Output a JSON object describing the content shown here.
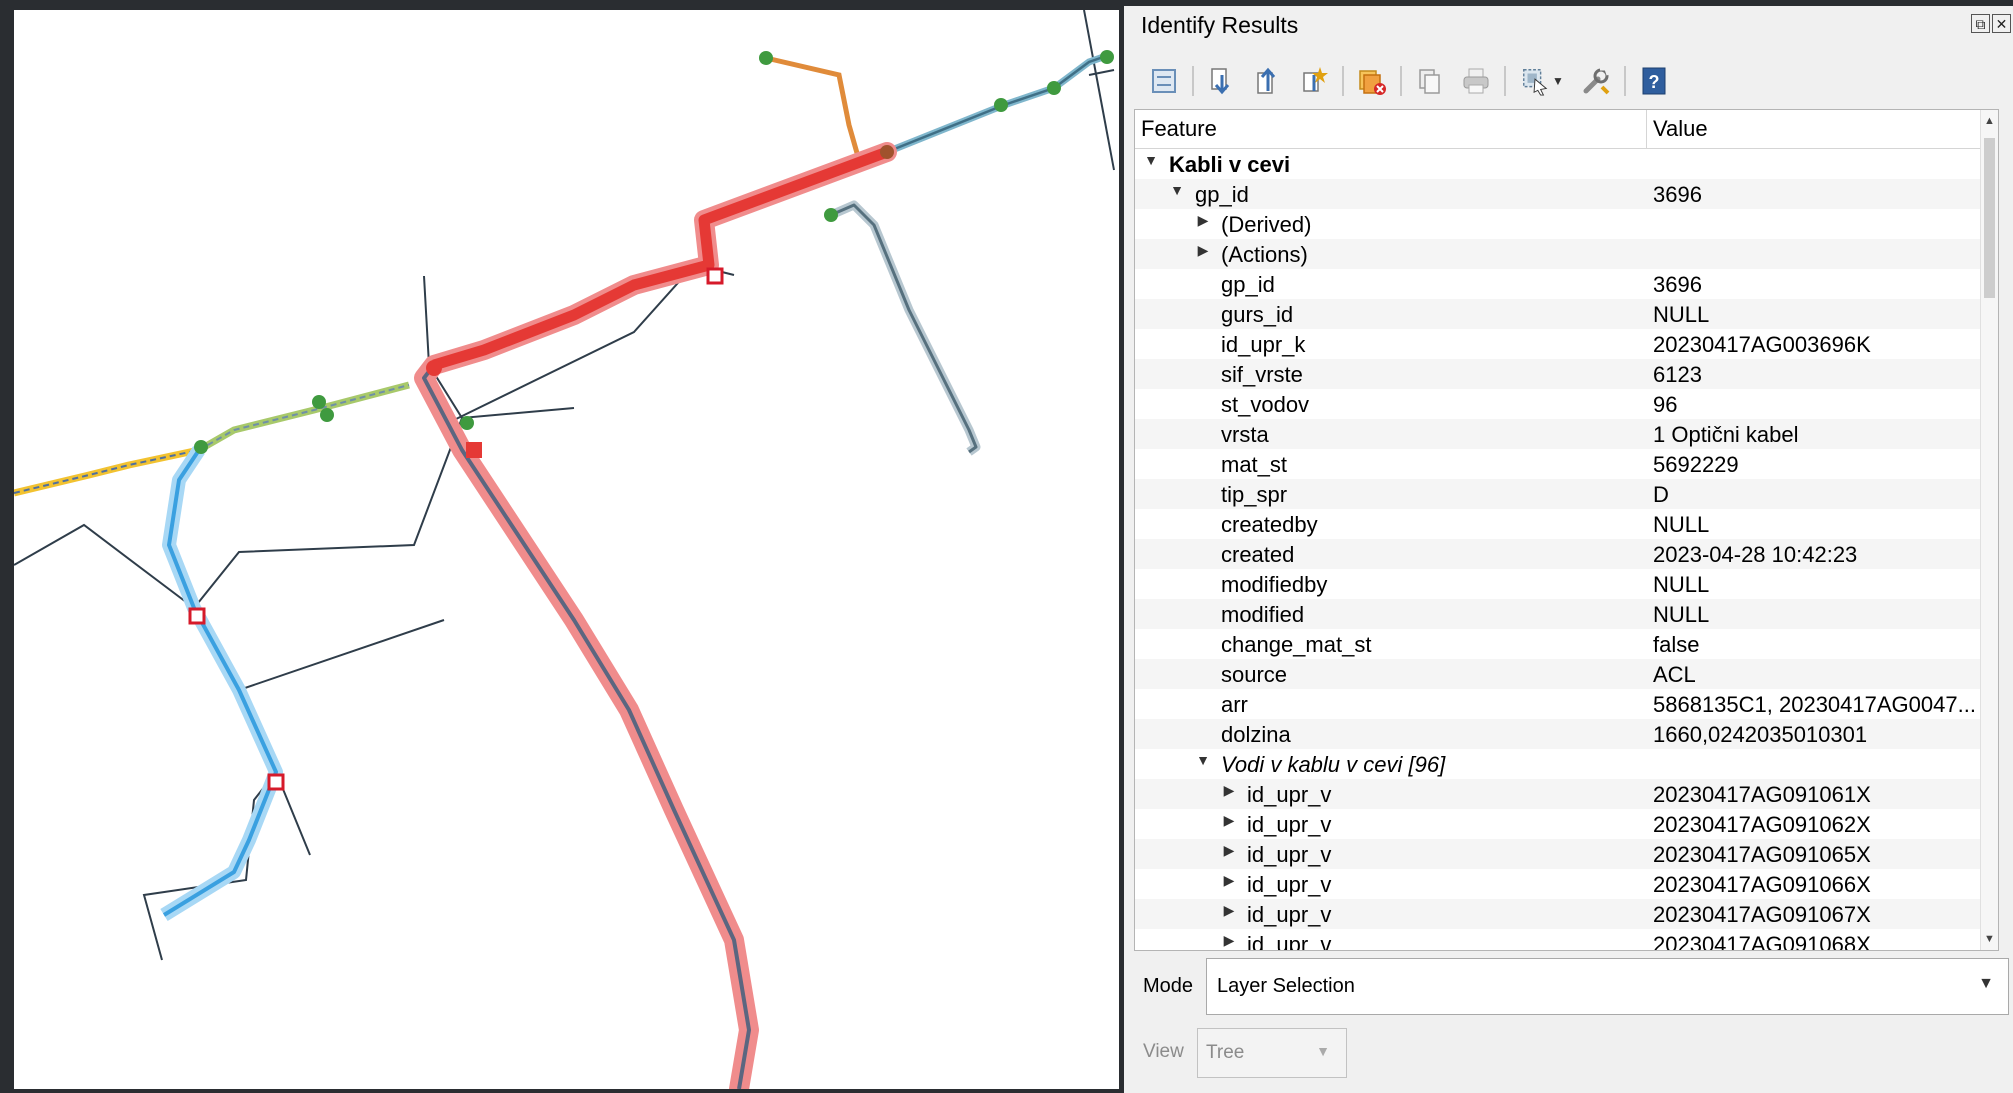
{
  "panel": {
    "title": "Identify Results",
    "restore_glyph": "⧉",
    "close_glyph": "✕",
    "toolbar": [
      {
        "name": "expand-tree-icon",
        "color": "#6a8fb8"
      },
      {
        "name": "expand-all-icon",
        "color": "#3b6fb0"
      },
      {
        "name": "collapse-all-icon",
        "color": "#3b6fb0"
      },
      {
        "name": "expand-new-results-icon",
        "color": "#e0a010"
      },
      {
        "name": "clear-results-icon",
        "color": "#e08010"
      },
      {
        "name": "copy-feature-icon",
        "color": "#9a9a9a"
      },
      {
        "name": "print-icon",
        "color": "#9a9a9a"
      },
      {
        "name": "select-features-icon",
        "color": "#5f7e98"
      },
      {
        "name": "settings-wrench-icon",
        "color": "#8a8a8a"
      },
      {
        "name": "help-icon",
        "color": "#2f5e9e"
      }
    ]
  },
  "tree": {
    "col_feature": "Feature",
    "col_value": "Value",
    "rows": [
      {
        "key": "Kabli v cevi",
        "value": "",
        "level": 0,
        "arrow": "down",
        "style": "bold"
      },
      {
        "key": "gp_id",
        "value": "3696",
        "level": 1,
        "arrow": "down",
        "style": ""
      },
      {
        "key": "(Derived)",
        "value": "",
        "level": 2,
        "arrow": "right",
        "style": ""
      },
      {
        "key": "(Actions)",
        "value": "",
        "level": 2,
        "arrow": "right",
        "style": ""
      },
      {
        "key": "gp_id",
        "value": "3696",
        "level": 2,
        "arrow": "",
        "style": ""
      },
      {
        "key": "gurs_id",
        "value": "NULL",
        "level": 2,
        "arrow": "",
        "style": ""
      },
      {
        "key": "id_upr_k",
        "value": "20230417AG003696K",
        "level": 2,
        "arrow": "",
        "style": ""
      },
      {
        "key": "sif_vrste",
        "value": "6123",
        "level": 2,
        "arrow": "",
        "style": ""
      },
      {
        "key": "st_vodov",
        "value": "96",
        "level": 2,
        "arrow": "",
        "style": ""
      },
      {
        "key": "vrsta",
        "value": "1 Optični kabel",
        "level": 2,
        "arrow": "",
        "style": ""
      },
      {
        "key": "mat_st",
        "value": "5692229",
        "level": 2,
        "arrow": "",
        "style": ""
      },
      {
        "key": "tip_spr",
        "value": "D",
        "level": 2,
        "arrow": "",
        "style": ""
      },
      {
        "key": "createdby",
        "value": "NULL",
        "level": 2,
        "arrow": "",
        "style": ""
      },
      {
        "key": "created",
        "value": "2023-04-28 10:42:23",
        "level": 2,
        "arrow": "",
        "style": ""
      },
      {
        "key": "modifiedby",
        "value": "NULL",
        "level": 2,
        "arrow": "",
        "style": ""
      },
      {
        "key": "modified",
        "value": "NULL",
        "level": 2,
        "arrow": "",
        "style": ""
      },
      {
        "key": "change_mat_st",
        "value": "false",
        "level": 2,
        "arrow": "",
        "style": ""
      },
      {
        "key": "source",
        "value": "ACL",
        "level": 2,
        "arrow": "",
        "style": ""
      },
      {
        "key": "arr",
        "value": "5868135C1, 20230417AG0047...",
        "level": 2,
        "arrow": "",
        "style": ""
      },
      {
        "key": "dolzina",
        "value": "1660,0242035010301",
        "level": 2,
        "arrow": "",
        "style": ""
      },
      {
        "key": "Vodi v kablu v cevi [96]",
        "value": "",
        "level": 2,
        "arrow": "down",
        "style": "italic"
      },
      {
        "key": "id_upr_v",
        "value": "20230417AG091061X",
        "level": 3,
        "arrow": "right",
        "style": ""
      },
      {
        "key": "id_upr_v",
        "value": "20230417AG091062X",
        "level": 3,
        "arrow": "right",
        "style": ""
      },
      {
        "key": "id_upr_v",
        "value": "20230417AG091065X",
        "level": 3,
        "arrow": "right",
        "style": ""
      },
      {
        "key": "id_upr_v",
        "value": "20230417AG091066X",
        "level": 3,
        "arrow": "right",
        "style": ""
      },
      {
        "key": "id_upr_v",
        "value": "20230417AG091067X",
        "level": 3,
        "arrow": "right",
        "style": ""
      },
      {
        "key": "id_upr_v",
        "value": "20230417AG091068X",
        "level": 3,
        "arrow": "right",
        "style": ""
      }
    ]
  },
  "mode": {
    "label": "Mode",
    "value": "Layer Selection"
  },
  "view": {
    "label": "View",
    "value": "Tree"
  },
  "colors": {
    "selection_red": "#e53935",
    "selection_halo": "#ef6f6f",
    "water_blue": "#3aa0e0",
    "orange_line": "#e08b3a",
    "gray_line": "#6e8490",
    "teal_line": "#4f8aa6",
    "yellow_line": "#f2c230",
    "green_node": "#3f9a3f",
    "thin_line": "#2f3d4a"
  }
}
